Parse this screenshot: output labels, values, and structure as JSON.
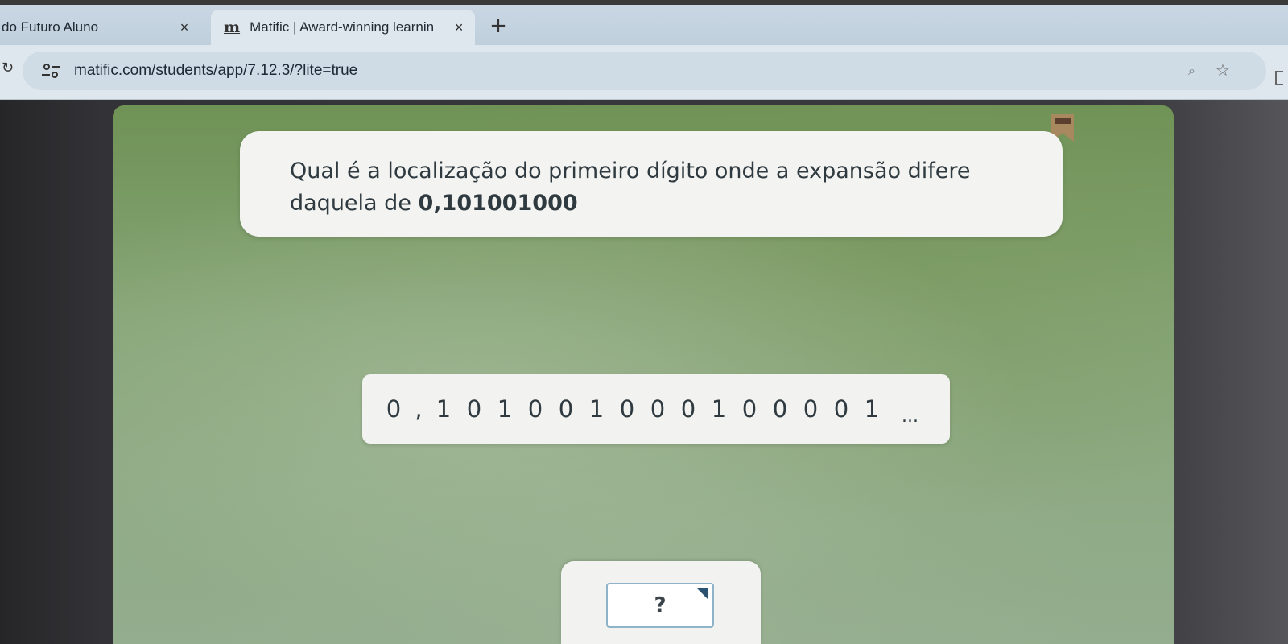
{
  "browser": {
    "tabs": [
      {
        "title": "do Futuro Aluno",
        "close": "×",
        "active": false
      },
      {
        "title": "Matific | Award-winning learnin",
        "close": "×",
        "active": true
      }
    ],
    "new_tab_label": "+",
    "url": "matific.com/students/app/7.12.3/?lite=true",
    "icons": [
      "reload-icon",
      "site-info-icon",
      "lens-icon",
      "star-icon"
    ]
  },
  "question": {
    "text": "Qual é a localização do primeiro dígito onde a expansão difere daquela de ",
    "number": "0,101001000"
  },
  "expansion": {
    "digits": [
      "0",
      ",",
      "1",
      "0",
      "1",
      "0",
      "0",
      "1",
      "0",
      "0",
      "0",
      "1",
      "0",
      "0",
      "0",
      "0",
      "1"
    ],
    "ellipsis": "..."
  },
  "answer": {
    "value": "?"
  },
  "colors": {
    "board_green": "#86a576",
    "card_bg": "#f3f4f1",
    "text": "#2f3a40",
    "caret": "#2c5272"
  }
}
